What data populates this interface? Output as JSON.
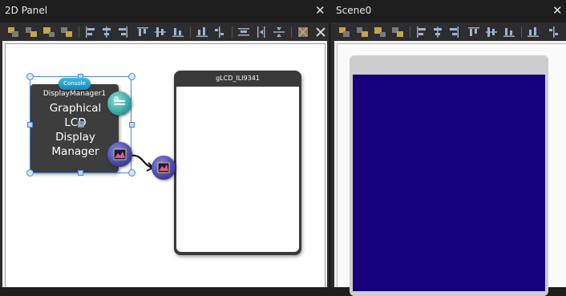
{
  "left_panel": {
    "title": "2D Panel",
    "close_glyph": "✕"
  },
  "right_panel": {
    "title": "Scene0",
    "close_glyph": "✕"
  },
  "toolbar_icons": [
    "align-left-icon",
    "align-top-icon",
    "align-right-icon",
    "align-bottom-icon",
    "align-horizontal-left-icon",
    "align-horizontal-center-icon",
    "align-horizontal-right-icon",
    "align-vertical-top-icon",
    "align-vertical-center-icon",
    "align-vertical-bottom-icon",
    "distribute-horizontal-icon",
    "distribute-vertical-icon",
    "same-width-icon",
    "same-height-icon",
    "same-size-icon",
    "grid-snap-icon",
    "delete-icon"
  ],
  "display_manager": {
    "instance_name": "DisplayManager1",
    "label_lines": [
      "Graphical",
      "LCD",
      "Display",
      "Manager"
    ],
    "badge": "Console",
    "port_top_icon": "console-pin-icon",
    "port_bottom_icon": "display-graph-icon"
  },
  "lcd_component": {
    "title": "gLCD_ILI9341",
    "input_port_icon": "display-graph-icon"
  },
  "colors": {
    "selection": "#4a86d6",
    "scene_screen": "#16007a",
    "console_badge": "#1e9fd0"
  }
}
